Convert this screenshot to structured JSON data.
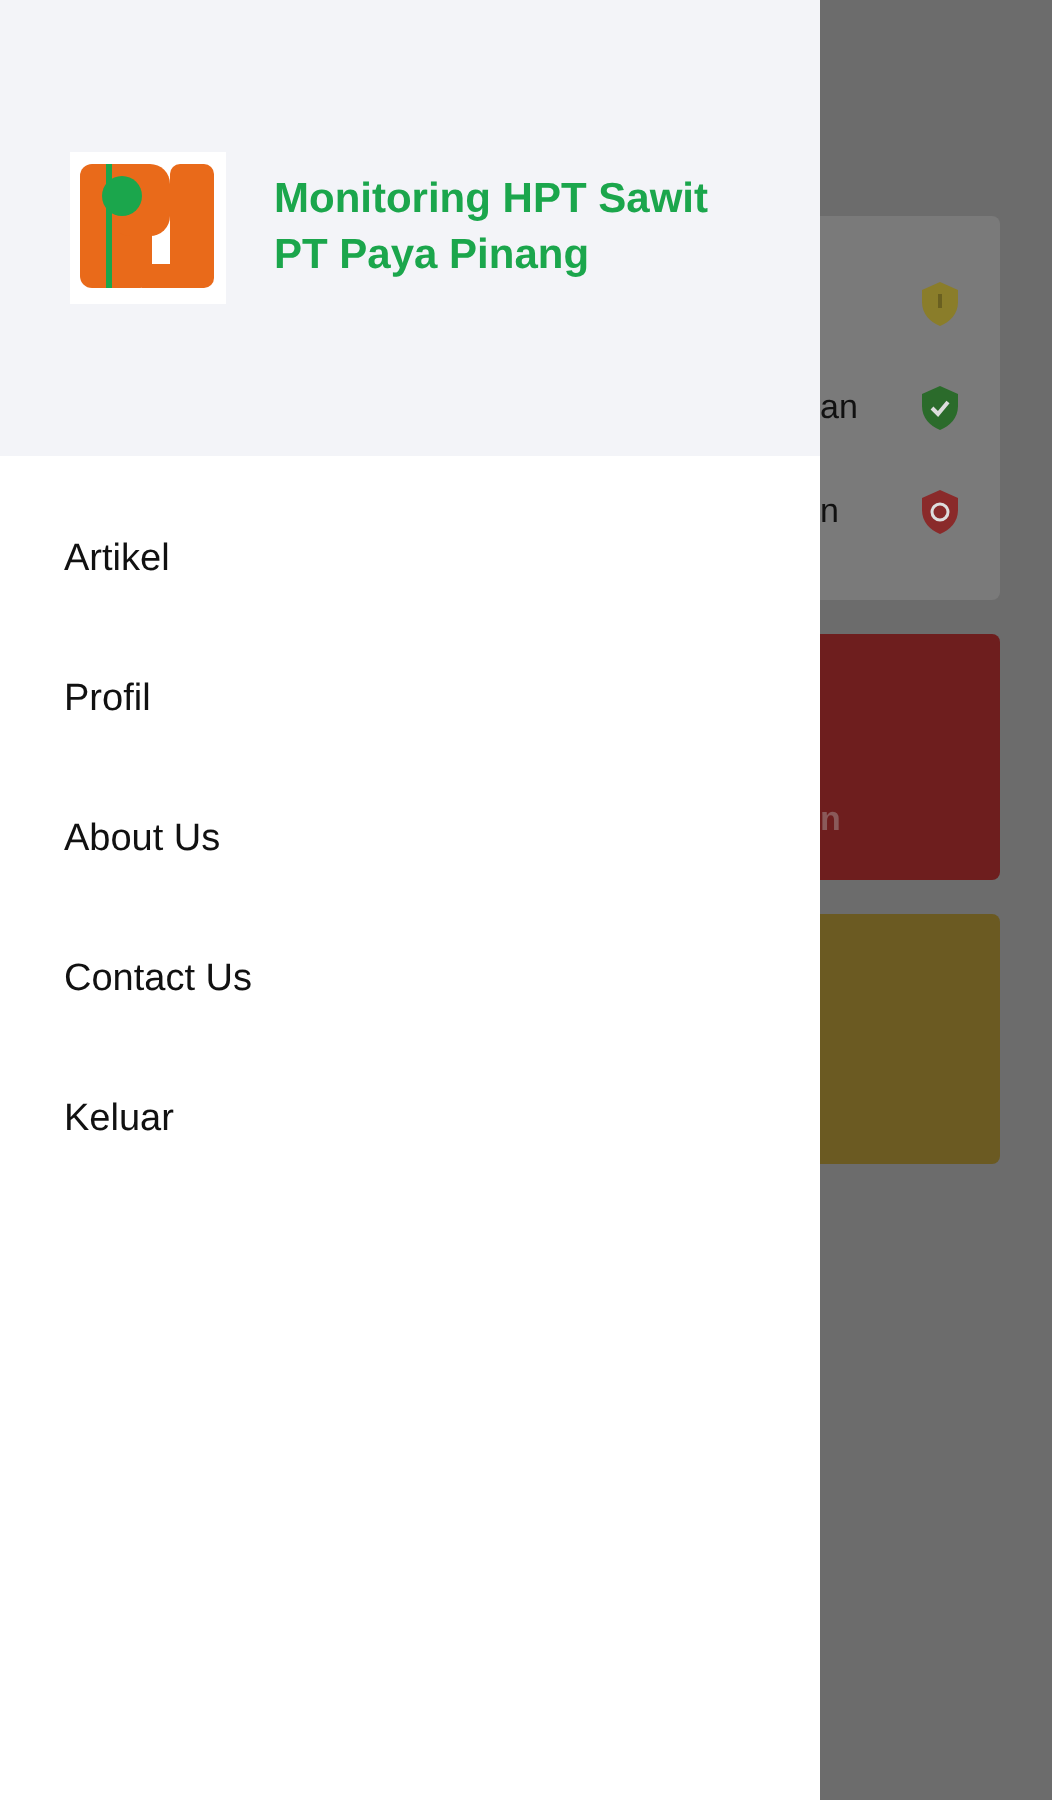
{
  "drawer": {
    "title_lines": [
      "Monitoring HPT Sawit",
      "PT Paya Pinang"
    ],
    "menu": [
      {
        "label": "Artikel"
      },
      {
        "label": "Profil"
      },
      {
        "label": "About Us"
      },
      {
        "label": "Contact Us"
      },
      {
        "label": "Keluar"
      }
    ]
  },
  "background": {
    "status_rows": [
      {
        "kind": "warning"
      },
      {
        "kind": "ok",
        "text": "an"
      },
      {
        "kind": "blocked",
        "text": "n"
      }
    ],
    "red_card": {
      "text": "n"
    }
  }
}
